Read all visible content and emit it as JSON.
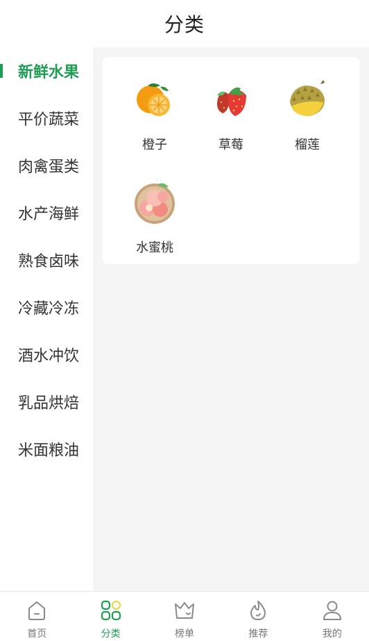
{
  "header": {
    "title": "分类"
  },
  "sidebar": {
    "items": [
      {
        "label": "新鲜水果",
        "active": true
      },
      {
        "label": "平价蔬菜",
        "active": false
      },
      {
        "label": "肉禽蛋类",
        "active": false
      },
      {
        "label": "水产海鲜",
        "active": false
      },
      {
        "label": "熟食卤味",
        "active": false
      },
      {
        "label": "冷藏冷冻",
        "active": false
      },
      {
        "label": "酒水冲饮",
        "active": false
      },
      {
        "label": "乳品烘焙",
        "active": false
      },
      {
        "label": "米面粮油",
        "active": false
      }
    ]
  },
  "products": [
    {
      "name": "橙子",
      "icon": "orange-icon"
    },
    {
      "name": "草莓",
      "icon": "strawberry-icon"
    },
    {
      "name": "榴莲",
      "icon": "durian-icon"
    },
    {
      "name": "水蜜桃",
      "icon": "peach-icon"
    }
  ],
  "tabbar": {
    "items": [
      {
        "label": "首页",
        "icon": "home-icon",
        "active": false
      },
      {
        "label": "分类",
        "icon": "category-icon",
        "active": true
      },
      {
        "label": "榜单",
        "icon": "crown-icon",
        "active": false
      },
      {
        "label": "推荐",
        "icon": "flame-icon",
        "active": false
      },
      {
        "label": "我的",
        "icon": "user-icon",
        "active": false
      }
    ]
  },
  "colors": {
    "accent": "#1f9d55",
    "content_bg": "#f5f5f5",
    "category_yellow": "#e6d84a"
  }
}
